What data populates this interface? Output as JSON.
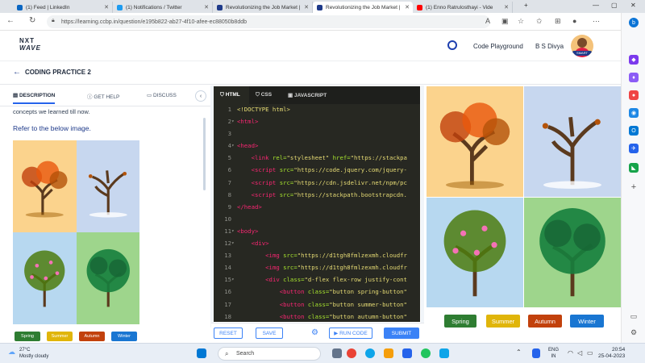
{
  "browser": {
    "tabs": [
      {
        "label": "(1) Feed | LinkedIn",
        "color": "#0a66c2"
      },
      {
        "label": "(1) Notifications / Twitter",
        "color": "#1d9bf0"
      },
      {
        "label": "Revolutionizing the Job Market |",
        "color": "#1e3a8a"
      },
      {
        "label": "Revolutionizing the Job Market |",
        "color": "#1e3a8a",
        "active": true
      },
      {
        "label": "(1) Enno Ratrulosthayi - Vide",
        "color": "#ff0000"
      }
    ],
    "url": "https://learning.ccbp.in/question/e195b822-ab27-4f10-afee-ec88050b8ddb"
  },
  "header": {
    "logo_line1": "NXT",
    "logo_line2": "WAVE",
    "code_playground": "Code Playground",
    "user_name": "B S Divya",
    "avatar_badge": "SMART"
  },
  "subheader": {
    "title": "CODING PRACTICE 2"
  },
  "left_panel": {
    "tabs": {
      "description": "DESCRIPTION",
      "get_help": "GET HELP",
      "discuss": "DISCUSS"
    },
    "text1": "concepts we learned till now.",
    "text2": "Refer to the below image.",
    "buttons": {
      "spring": "Spring",
      "summer": "Summer",
      "autumn": "Autumn",
      "winter": "Winter"
    }
  },
  "editor": {
    "tabs": {
      "html": "HTML",
      "css": "CSS",
      "javascript": "JAVASCRIPT"
    },
    "lines": [
      {
        "n": "1",
        "fold": "",
        "html": "<span class='str'>&lt;!DOCTYPE html&gt;</span>"
      },
      {
        "n": "2",
        "fold": "▾",
        "html": "<span class='tag'>&lt;html&gt;</span>"
      },
      {
        "n": "3",
        "fold": "",
        "html": ""
      },
      {
        "n": "4",
        "fold": "▾",
        "html": "<span class='tag'>&lt;head&gt;</span>"
      },
      {
        "n": "5",
        "fold": "",
        "html": "    <span class='tag'>&lt;link</span> <span class='attr'>rel=</span><span class='str'>\"stylesheet\"</span> <span class='attr'>href=</span><span class='str'>\"https://stackpa</span>"
      },
      {
        "n": "6",
        "fold": "",
        "html": "    <span class='tag'>&lt;script</span> <span class='attr'>src=</span><span class='str'>\"https://code.jquery.com/jquery-</span>"
      },
      {
        "n": "7",
        "fold": "",
        "html": "    <span class='tag'>&lt;script</span> <span class='attr'>src=</span><span class='str'>\"https://cdn.jsdelivr.net/npm/pc</span>"
      },
      {
        "n": "8",
        "fold": "",
        "html": "    <span class='tag'>&lt;script</span> <span class='attr'>src=</span><span class='str'>\"https://stackpath.bootstrapcdn.</span>"
      },
      {
        "n": "9",
        "fold": "",
        "html": "<span class='tag'>&lt;/head&gt;</span>"
      },
      {
        "n": "10",
        "fold": "",
        "html": ""
      },
      {
        "n": "11",
        "fold": "▾",
        "html": "<span class='tag'>&lt;body&gt;</span>"
      },
      {
        "n": "12",
        "fold": "▾",
        "html": "    <span class='tag'>&lt;div&gt;</span>"
      },
      {
        "n": "13",
        "fold": "",
        "html": "        <span class='tag'>&lt;img</span> <span class='attr'>src=</span><span class='str'>\"https://d1tgh8fmlzexmh.cloudfr</span>"
      },
      {
        "n": "14",
        "fold": "",
        "html": "        <span class='tag'>&lt;img</span> <span class='attr'>src=</span><span class='str'>\"https://d1tgh8fmlzexmh.cloudfr</span>"
      },
      {
        "n": "15",
        "fold": "▾",
        "html": "        <span class='tag'>&lt;div</span> <span class='attr'>class=</span><span class='str'>\"d-flex flex-row justify-cont</span>"
      },
      {
        "n": "16",
        "fold": "",
        "html": "            <span class='tag'>&lt;button</span> <span class='attr'>class=</span><span class='str'>\"button spring-button\"</span>"
      },
      {
        "n": "17",
        "fold": "",
        "html": "            <span class='tag'>&lt;button</span> <span class='attr'>class=</span><span class='str'>\"button summer-button\"</span>"
      },
      {
        "n": "18",
        "fold": "",
        "html": "            <span class='tag'>&lt;button</span> <span class='attr'>class=</span><span class='str'>\"button autumn-button\"</span>"
      }
    ],
    "bottom": {
      "reset": "RESET",
      "save": "SAVE",
      "run_code": "RUN CODE",
      "submit": "SUBMIT"
    }
  },
  "preview": {
    "buttons": {
      "spring": "Spring",
      "summer": "Summer",
      "autumn": "Autumn",
      "winter": "Winter"
    }
  },
  "taskbar": {
    "temperature": "27°C",
    "weather": "Mostly cloudy",
    "search": "Search",
    "lang1": "ENG",
    "lang2": "IN",
    "time": "20:54",
    "date": "25-04-2023"
  },
  "colors": {
    "spring_btn": "#2e7d32",
    "summer_btn": "#e0b50a",
    "autumn_btn": "#c2410c",
    "winter_btn": "#1976d2",
    "submit_btn": "#3b82f6",
    "editor_bg": "#272822"
  }
}
